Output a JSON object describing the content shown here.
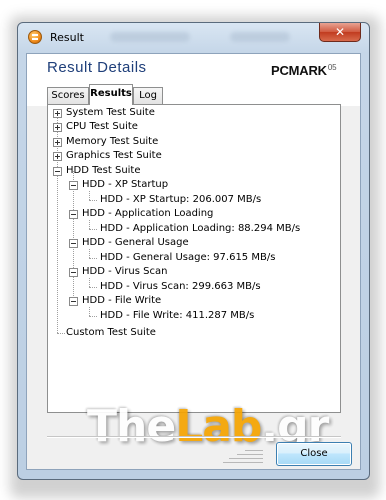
{
  "window": {
    "title": "Result",
    "close_glyph": "✕"
  },
  "header": {
    "title": "Result Details",
    "logo_main": "PCMARK",
    "logo_sub": "05"
  },
  "tabs": [
    {
      "label": "Scores",
      "active": false
    },
    {
      "label": "Results",
      "active": true
    },
    {
      "label": "Log",
      "active": false
    }
  ],
  "tree": {
    "items": [
      {
        "label": "System Test Suite",
        "expanded": false
      },
      {
        "label": "CPU Test Suite",
        "expanded": false
      },
      {
        "label": "Memory Test Suite",
        "expanded": false
      },
      {
        "label": "Graphics Test Suite",
        "expanded": false
      },
      {
        "label": "HDD Test Suite",
        "expanded": true,
        "children": [
          {
            "label": "HDD - XP Startup",
            "result": "HDD - XP Startup: 206.007 MB/s"
          },
          {
            "label": "HDD - Application Loading",
            "result": "HDD - Application Loading: 88.294 MB/s"
          },
          {
            "label": "HDD - General Usage",
            "result": "HDD - General Usage: 97.615 MB/s"
          },
          {
            "label": "HDD - Virus Scan",
            "result": "HDD - Virus Scan: 299.663 MB/s"
          },
          {
            "label": "HDD - File Write",
            "result": "HDD - File Write: 411.287 MB/s"
          }
        ]
      },
      {
        "label": "Custom Test Suite",
        "expanded": false
      }
    ]
  },
  "watermark": {
    "part1": "The",
    "part2": "Lab",
    "part3": ".gr"
  },
  "footer": {
    "close_label": "Close"
  },
  "colors": {
    "header_title": "#1f3f7a",
    "watermark_accent": "#f5a300"
  }
}
